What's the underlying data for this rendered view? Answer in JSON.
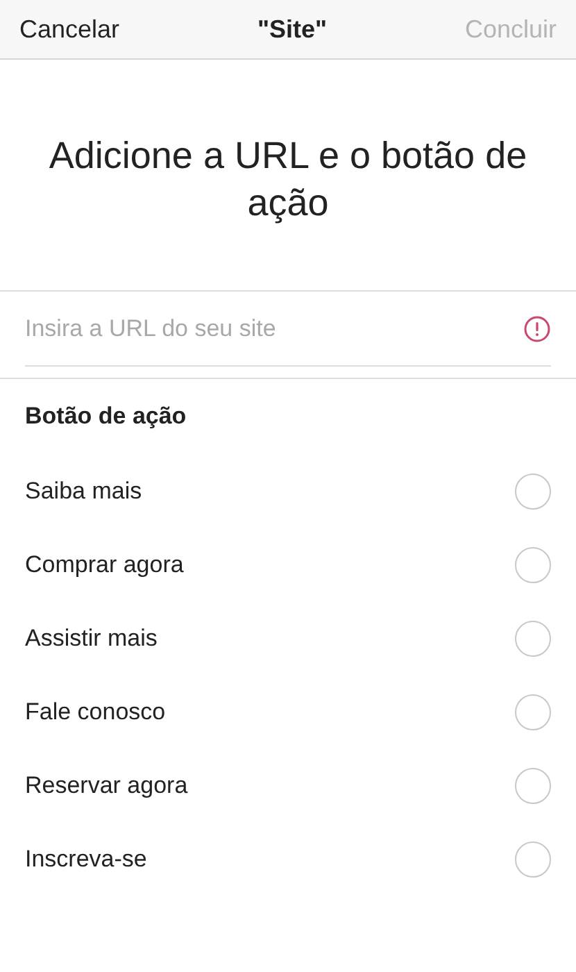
{
  "nav": {
    "cancel": "Cancelar",
    "title": "\"Site\"",
    "done": {
      "label": "Concluir",
      "disabled": true
    }
  },
  "heading": "Adicione a URL e o botão de ação",
  "url_field": {
    "placeholder": "Insira a URL do seu site",
    "error": true
  },
  "section_title": "Botão de ação",
  "options": [
    {
      "label": "Saiba mais",
      "selected": false
    },
    {
      "label": "Comprar agora",
      "selected": false
    },
    {
      "label": "Assistir mais",
      "selected": false
    },
    {
      "label": "Fale conosco",
      "selected": false
    },
    {
      "label": "Reservar agora",
      "selected": false
    },
    {
      "label": "Inscreva-se",
      "selected": false
    }
  ]
}
